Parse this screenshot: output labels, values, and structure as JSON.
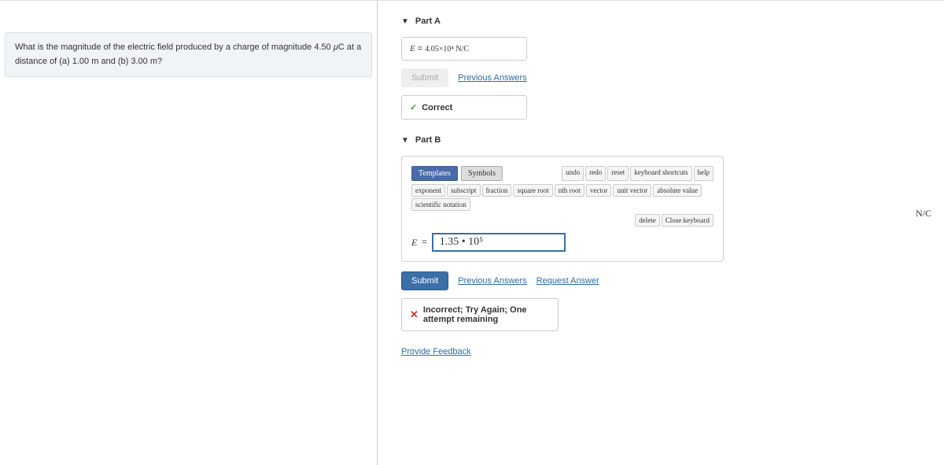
{
  "question": {
    "prefix": "What is the magnitude of the electric field produced by a charge of magnitude 4.50 ",
    "mu": "μ",
    "c": "C",
    "mid": " at a distance of (a) 1.00 ",
    "m1": "m",
    "and": " and (b) 3.00 ",
    "m2": "m",
    "q": "?"
  },
  "partA": {
    "title": "Part A",
    "eq": "E",
    "equals": " = ",
    "value": "4.05×10⁴  N/C",
    "submit": "Submit",
    "prev": "Previous Answers",
    "correct": "Correct"
  },
  "partB": {
    "title": "Part B",
    "tabs": {
      "templates": "Templates",
      "symbols": "Symbols"
    },
    "tbar": {
      "undo": "undo",
      "redo": "redo",
      "reset": "reset",
      "keyboard": "keyboard shortcuts",
      "help": "help"
    },
    "tools": {
      "exponent": "exponent",
      "subscript": "subscript",
      "fraction": "fraction",
      "sqrt": "square root",
      "nroot": "nth root",
      "vector": "vector",
      "unitvec": "unit vector",
      "absval": "absolute value",
      "scinot": "scientific notation"
    },
    "close": {
      "delete": "delete",
      "closekb": "Close keyboard"
    },
    "eq": "E",
    "equals": " = ",
    "input": "1.35 • 10⁵",
    "unit": "N/C",
    "submit": "Submit",
    "prev": "Previous Answers",
    "request": "Request Answer",
    "incorrect": "Incorrect; Try Again; One attempt remaining"
  },
  "feedback": "Provide Feedback"
}
